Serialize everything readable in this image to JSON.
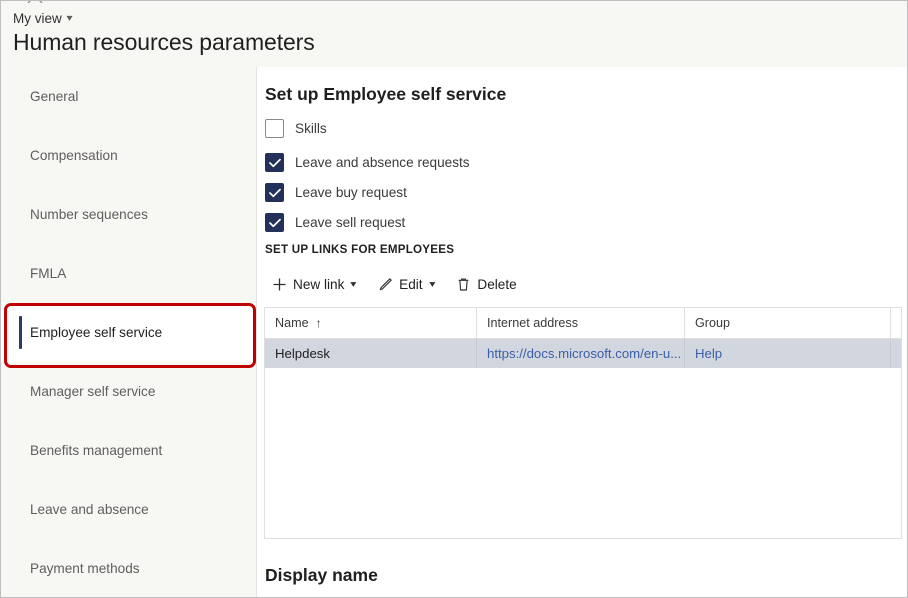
{
  "header": {
    "view_switcher_label": "My view",
    "view_switcher_chevron": "chevron-down-icon",
    "page_title": "Human resources parameters"
  },
  "sidebar": {
    "items": [
      {
        "label": "General",
        "selected": false
      },
      {
        "label": "Compensation",
        "selected": false
      },
      {
        "label": "Number sequences",
        "selected": false
      },
      {
        "label": "FMLA",
        "selected": false
      },
      {
        "label": "Employee self service",
        "selected": true
      },
      {
        "label": "Manager self service",
        "selected": false
      },
      {
        "label": "Benefits management",
        "selected": false
      },
      {
        "label": "Leave and absence",
        "selected": false
      },
      {
        "label": "Payment methods",
        "selected": false
      }
    ]
  },
  "annotation": {
    "type": "highlight-rectangle",
    "color": "#c00000",
    "target": "Employee self service"
  },
  "main": {
    "section_title": "Set up Employee self service",
    "checkboxes": [
      {
        "label": "Skills",
        "checked": false
      },
      {
        "label": "Leave and absence requests",
        "checked": true
      },
      {
        "label": "Leave buy request",
        "checked": true
      },
      {
        "label": "Leave sell request",
        "checked": true
      }
    ],
    "links_section_label": "SET UP LINKS FOR EMPLOYEES",
    "toolbar": [
      {
        "label": "New link",
        "icon": "plus-icon",
        "has_chevron": true
      },
      {
        "label": "Edit",
        "icon": "pencil-icon",
        "has_chevron": true
      },
      {
        "label": "Delete",
        "icon": "trash-icon",
        "has_chevron": false
      }
    ],
    "grid": {
      "columns": [
        {
          "label": "Name",
          "sorted": true,
          "sort_icon": "arrow-up-icon"
        },
        {
          "label": "Internet address",
          "sorted": false,
          "sort_icon": ""
        },
        {
          "label": "Group",
          "sorted": false,
          "sort_icon": ""
        }
      ],
      "rows": [
        {
          "name": "Helpdesk",
          "internet_address": "https://docs.microsoft.com/en-u...",
          "group": "Help",
          "selected": true
        }
      ]
    },
    "bottom_section_title": "Display name"
  },
  "colors": {
    "checkbox_checked": "#23305a",
    "selected_nav_bar": "#2b3a67",
    "annotation_red": "#c00000",
    "row_selected": "#d2d6de",
    "link_text": "#3b5fa8",
    "sidebar_bg": "#f7f7f4",
    "content_bg": "#ffffff"
  }
}
